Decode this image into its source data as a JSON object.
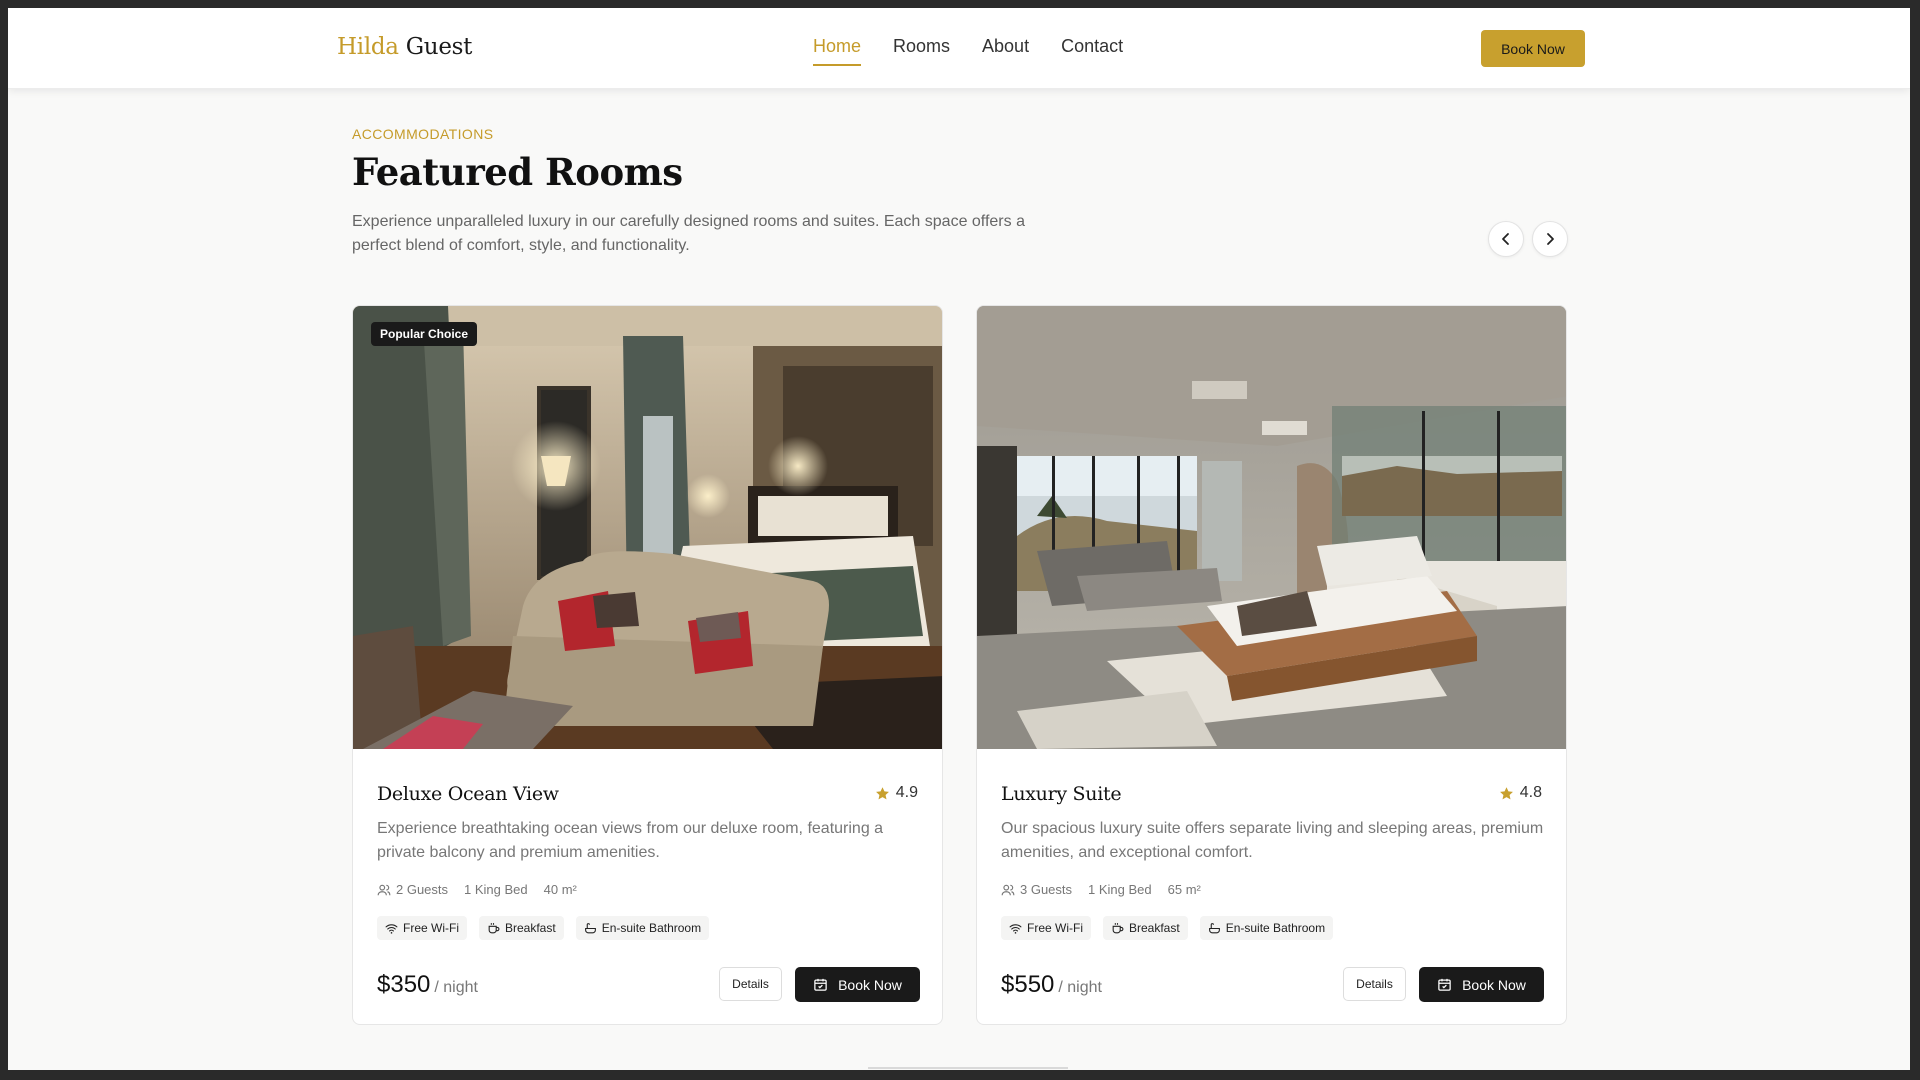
{
  "brand": {
    "name_part1": "Hilda",
    "name_part2": "Guest"
  },
  "nav": {
    "items": [
      {
        "label": "Home",
        "active": true
      },
      {
        "label": "Rooms",
        "active": false
      },
      {
        "label": "About",
        "active": false
      },
      {
        "label": "Contact",
        "active": false
      }
    ],
    "cta_label": "Book Now"
  },
  "section": {
    "eyebrow": "ACCOMMODATIONS",
    "title": "Featured Rooms",
    "description": "Experience unparalleled luxury in our carefully designed rooms and suites. Each space offers a perfect blend of comfort, style, and functionality.",
    "prev_icon": "chevron-left-icon",
    "next_icon": "chevron-right-icon"
  },
  "rooms": [
    {
      "badge": "Popular Choice",
      "title": "Deluxe Ocean View",
      "rating": "4.9",
      "description": "Experience breathtaking ocean views from our deluxe room, featuring a private balcony and premium amenities.",
      "guests": "2 Guests",
      "bed": "1 King Bed",
      "size": "40 m²",
      "amenities": [
        "Free Wi-Fi",
        "Breakfast",
        "En-suite Bathroom"
      ],
      "price": "$350",
      "price_unit": "/ night",
      "details_label": "Details",
      "book_label": "Book Now"
    },
    {
      "title": "Luxury Suite",
      "rating": "4.8",
      "description": "Our spacious luxury suite offers separate living and sleeping areas, premium amenities, and exceptional comfort.",
      "guests": "3 Guests",
      "bed": "1 King Bed",
      "size": "65 m²",
      "amenities": [
        "Free Wi-Fi",
        "Breakfast",
        "En-suite Bathroom"
      ],
      "price": "$550",
      "price_unit": "/ night",
      "details_label": "Details",
      "book_label": "Book Now"
    }
  ],
  "colors": {
    "accent": "#c59b2a",
    "button_dark": "#1a1a1a",
    "star": "#c8a02e"
  }
}
